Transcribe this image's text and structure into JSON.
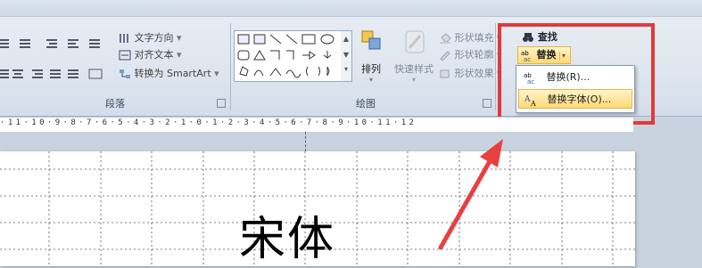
{
  "paragraph_group": {
    "text_direction_label": "文字方向",
    "align_text_label": "对齐文本",
    "convert_smartart_label": "转换为 SmartArt",
    "title": "段落"
  },
  "drawing_group": {
    "arrange_label": "排列",
    "quick_styles_label": "快速样式",
    "shape_fill_label": "形状填充",
    "shape_outline_label": "形状轮廓",
    "shape_effects_label": "形状效果",
    "title": "绘图"
  },
  "editing_group": {
    "find_label": "查找",
    "replace_label": "替换"
  },
  "replace_menu": {
    "items": [
      "替换(R)...",
      "替换字体(O)..."
    ]
  },
  "ruler": {
    "text": "·11·10·9·8·7·6·5·4·3·2·1·0·1·2·3·4·5·6·7·8·9·10·11·12"
  },
  "slide": {
    "text": "宋体"
  },
  "colors": {
    "highlight": "#e23a3a",
    "menu_selected": "#ffd977"
  }
}
